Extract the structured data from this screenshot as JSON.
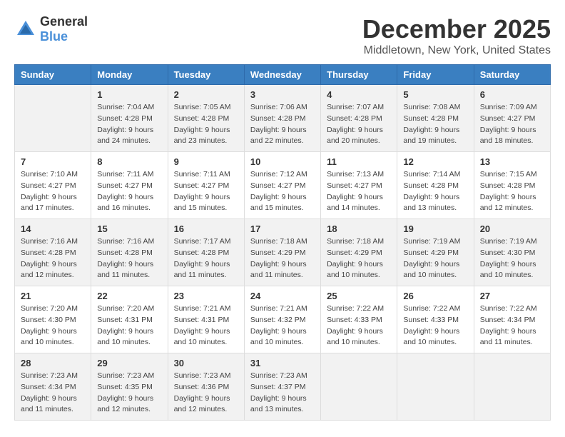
{
  "header": {
    "logo_general": "General",
    "logo_blue": "Blue",
    "month": "December 2025",
    "location": "Middletown, New York, United States"
  },
  "weekdays": [
    "Sunday",
    "Monday",
    "Tuesday",
    "Wednesday",
    "Thursday",
    "Friday",
    "Saturday"
  ],
  "weeks": [
    [
      {
        "day": "",
        "empty": true
      },
      {
        "day": "1",
        "sunrise": "7:04 AM",
        "sunset": "4:28 PM",
        "daylight": "9 hours and 24 minutes."
      },
      {
        "day": "2",
        "sunrise": "7:05 AM",
        "sunset": "4:28 PM",
        "daylight": "9 hours and 23 minutes."
      },
      {
        "day": "3",
        "sunrise": "7:06 AM",
        "sunset": "4:28 PM",
        "daylight": "9 hours and 22 minutes."
      },
      {
        "day": "4",
        "sunrise": "7:07 AM",
        "sunset": "4:28 PM",
        "daylight": "9 hours and 20 minutes."
      },
      {
        "day": "5",
        "sunrise": "7:08 AM",
        "sunset": "4:28 PM",
        "daylight": "9 hours and 19 minutes."
      },
      {
        "day": "6",
        "sunrise": "7:09 AM",
        "sunset": "4:27 PM",
        "daylight": "9 hours and 18 minutes."
      }
    ],
    [
      {
        "day": "7",
        "sunrise": "7:10 AM",
        "sunset": "4:27 PM",
        "daylight": "9 hours and 17 minutes."
      },
      {
        "day": "8",
        "sunrise": "7:11 AM",
        "sunset": "4:27 PM",
        "daylight": "9 hours and 16 minutes."
      },
      {
        "day": "9",
        "sunrise": "7:11 AM",
        "sunset": "4:27 PM",
        "daylight": "9 hours and 15 minutes."
      },
      {
        "day": "10",
        "sunrise": "7:12 AM",
        "sunset": "4:27 PM",
        "daylight": "9 hours and 15 minutes."
      },
      {
        "day": "11",
        "sunrise": "7:13 AM",
        "sunset": "4:27 PM",
        "daylight": "9 hours and 14 minutes."
      },
      {
        "day": "12",
        "sunrise": "7:14 AM",
        "sunset": "4:28 PM",
        "daylight": "9 hours and 13 minutes."
      },
      {
        "day": "13",
        "sunrise": "7:15 AM",
        "sunset": "4:28 PM",
        "daylight": "9 hours and 12 minutes."
      }
    ],
    [
      {
        "day": "14",
        "sunrise": "7:16 AM",
        "sunset": "4:28 PM",
        "daylight": "9 hours and 12 minutes."
      },
      {
        "day": "15",
        "sunrise": "7:16 AM",
        "sunset": "4:28 PM",
        "daylight": "9 hours and 11 minutes."
      },
      {
        "day": "16",
        "sunrise": "7:17 AM",
        "sunset": "4:28 PM",
        "daylight": "9 hours and 11 minutes."
      },
      {
        "day": "17",
        "sunrise": "7:18 AM",
        "sunset": "4:29 PM",
        "daylight": "9 hours and 11 minutes."
      },
      {
        "day": "18",
        "sunrise": "7:18 AM",
        "sunset": "4:29 PM",
        "daylight": "9 hours and 10 minutes."
      },
      {
        "day": "19",
        "sunrise": "7:19 AM",
        "sunset": "4:29 PM",
        "daylight": "9 hours and 10 minutes."
      },
      {
        "day": "20",
        "sunrise": "7:19 AM",
        "sunset": "4:30 PM",
        "daylight": "9 hours and 10 minutes."
      }
    ],
    [
      {
        "day": "21",
        "sunrise": "7:20 AM",
        "sunset": "4:30 PM",
        "daylight": "9 hours and 10 minutes."
      },
      {
        "day": "22",
        "sunrise": "7:20 AM",
        "sunset": "4:31 PM",
        "daylight": "9 hours and 10 minutes."
      },
      {
        "day": "23",
        "sunrise": "7:21 AM",
        "sunset": "4:31 PM",
        "daylight": "9 hours and 10 minutes."
      },
      {
        "day": "24",
        "sunrise": "7:21 AM",
        "sunset": "4:32 PM",
        "daylight": "9 hours and 10 minutes."
      },
      {
        "day": "25",
        "sunrise": "7:22 AM",
        "sunset": "4:33 PM",
        "daylight": "9 hours and 10 minutes."
      },
      {
        "day": "26",
        "sunrise": "7:22 AM",
        "sunset": "4:33 PM",
        "daylight": "9 hours and 10 minutes."
      },
      {
        "day": "27",
        "sunrise": "7:22 AM",
        "sunset": "4:34 PM",
        "daylight": "9 hours and 11 minutes."
      }
    ],
    [
      {
        "day": "28",
        "sunrise": "7:23 AM",
        "sunset": "4:34 PM",
        "daylight": "9 hours and 11 minutes."
      },
      {
        "day": "29",
        "sunrise": "7:23 AM",
        "sunset": "4:35 PM",
        "daylight": "9 hours and 12 minutes."
      },
      {
        "day": "30",
        "sunrise": "7:23 AM",
        "sunset": "4:36 PM",
        "daylight": "9 hours and 12 minutes."
      },
      {
        "day": "31",
        "sunrise": "7:23 AM",
        "sunset": "4:37 PM",
        "daylight": "9 hours and 13 minutes."
      },
      {
        "day": "",
        "empty": true
      },
      {
        "day": "",
        "empty": true
      },
      {
        "day": "",
        "empty": true
      }
    ]
  ],
  "labels": {
    "sunrise": "Sunrise:",
    "sunset": "Sunset:",
    "daylight": "Daylight:"
  }
}
